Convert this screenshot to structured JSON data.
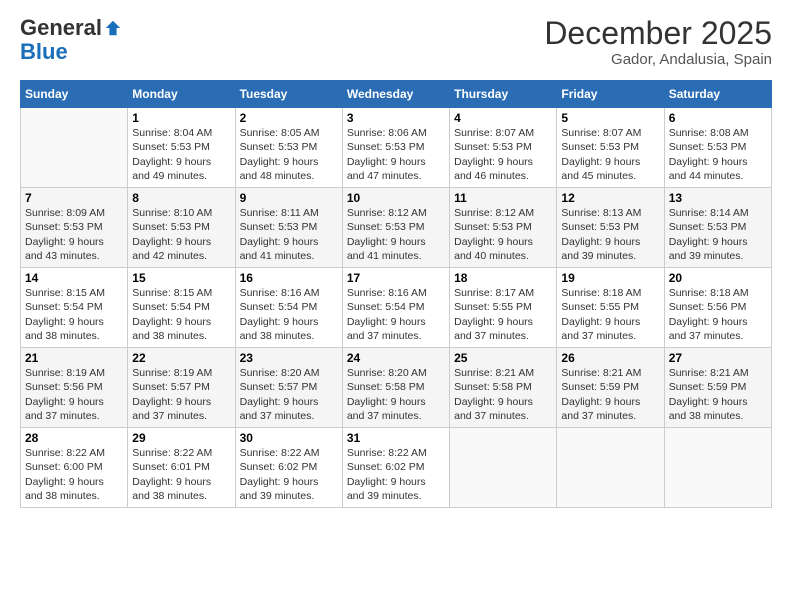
{
  "header": {
    "logo_general": "General",
    "logo_blue": "Blue",
    "month_title": "December 2025",
    "location": "Gador, Andalusia, Spain"
  },
  "calendar": {
    "days_of_week": [
      "Sunday",
      "Monday",
      "Tuesday",
      "Wednesday",
      "Thursday",
      "Friday",
      "Saturday"
    ],
    "weeks": [
      [
        {
          "day": "",
          "info": ""
        },
        {
          "day": "1",
          "info": "Sunrise: 8:04 AM\nSunset: 5:53 PM\nDaylight: 9 hours\nand 49 minutes."
        },
        {
          "day": "2",
          "info": "Sunrise: 8:05 AM\nSunset: 5:53 PM\nDaylight: 9 hours\nand 48 minutes."
        },
        {
          "day": "3",
          "info": "Sunrise: 8:06 AM\nSunset: 5:53 PM\nDaylight: 9 hours\nand 47 minutes."
        },
        {
          "day": "4",
          "info": "Sunrise: 8:07 AM\nSunset: 5:53 PM\nDaylight: 9 hours\nand 46 minutes."
        },
        {
          "day": "5",
          "info": "Sunrise: 8:07 AM\nSunset: 5:53 PM\nDaylight: 9 hours\nand 45 minutes."
        },
        {
          "day": "6",
          "info": "Sunrise: 8:08 AM\nSunset: 5:53 PM\nDaylight: 9 hours\nand 44 minutes."
        }
      ],
      [
        {
          "day": "7",
          "info": "Sunrise: 8:09 AM\nSunset: 5:53 PM\nDaylight: 9 hours\nand 43 minutes."
        },
        {
          "day": "8",
          "info": "Sunrise: 8:10 AM\nSunset: 5:53 PM\nDaylight: 9 hours\nand 42 minutes."
        },
        {
          "day": "9",
          "info": "Sunrise: 8:11 AM\nSunset: 5:53 PM\nDaylight: 9 hours\nand 41 minutes."
        },
        {
          "day": "10",
          "info": "Sunrise: 8:12 AM\nSunset: 5:53 PM\nDaylight: 9 hours\nand 41 minutes."
        },
        {
          "day": "11",
          "info": "Sunrise: 8:12 AM\nSunset: 5:53 PM\nDaylight: 9 hours\nand 40 minutes."
        },
        {
          "day": "12",
          "info": "Sunrise: 8:13 AM\nSunset: 5:53 PM\nDaylight: 9 hours\nand 39 minutes."
        },
        {
          "day": "13",
          "info": "Sunrise: 8:14 AM\nSunset: 5:53 PM\nDaylight: 9 hours\nand 39 minutes."
        }
      ],
      [
        {
          "day": "14",
          "info": "Sunrise: 8:15 AM\nSunset: 5:54 PM\nDaylight: 9 hours\nand 38 minutes."
        },
        {
          "day": "15",
          "info": "Sunrise: 8:15 AM\nSunset: 5:54 PM\nDaylight: 9 hours\nand 38 minutes."
        },
        {
          "day": "16",
          "info": "Sunrise: 8:16 AM\nSunset: 5:54 PM\nDaylight: 9 hours\nand 38 minutes."
        },
        {
          "day": "17",
          "info": "Sunrise: 8:16 AM\nSunset: 5:54 PM\nDaylight: 9 hours\nand 37 minutes."
        },
        {
          "day": "18",
          "info": "Sunrise: 8:17 AM\nSunset: 5:55 PM\nDaylight: 9 hours\nand 37 minutes."
        },
        {
          "day": "19",
          "info": "Sunrise: 8:18 AM\nSunset: 5:55 PM\nDaylight: 9 hours\nand 37 minutes."
        },
        {
          "day": "20",
          "info": "Sunrise: 8:18 AM\nSunset: 5:56 PM\nDaylight: 9 hours\nand 37 minutes."
        }
      ],
      [
        {
          "day": "21",
          "info": "Sunrise: 8:19 AM\nSunset: 5:56 PM\nDaylight: 9 hours\nand 37 minutes."
        },
        {
          "day": "22",
          "info": "Sunrise: 8:19 AM\nSunset: 5:57 PM\nDaylight: 9 hours\nand 37 minutes."
        },
        {
          "day": "23",
          "info": "Sunrise: 8:20 AM\nSunset: 5:57 PM\nDaylight: 9 hours\nand 37 minutes."
        },
        {
          "day": "24",
          "info": "Sunrise: 8:20 AM\nSunset: 5:58 PM\nDaylight: 9 hours\nand 37 minutes."
        },
        {
          "day": "25",
          "info": "Sunrise: 8:21 AM\nSunset: 5:58 PM\nDaylight: 9 hours\nand 37 minutes."
        },
        {
          "day": "26",
          "info": "Sunrise: 8:21 AM\nSunset: 5:59 PM\nDaylight: 9 hours\nand 37 minutes."
        },
        {
          "day": "27",
          "info": "Sunrise: 8:21 AM\nSunset: 5:59 PM\nDaylight: 9 hours\nand 38 minutes."
        }
      ],
      [
        {
          "day": "28",
          "info": "Sunrise: 8:22 AM\nSunset: 6:00 PM\nDaylight: 9 hours\nand 38 minutes."
        },
        {
          "day": "29",
          "info": "Sunrise: 8:22 AM\nSunset: 6:01 PM\nDaylight: 9 hours\nand 38 minutes."
        },
        {
          "day": "30",
          "info": "Sunrise: 8:22 AM\nSunset: 6:02 PM\nDaylight: 9 hours\nand 39 minutes."
        },
        {
          "day": "31",
          "info": "Sunrise: 8:22 AM\nSunset: 6:02 PM\nDaylight: 9 hours\nand 39 minutes."
        },
        {
          "day": "",
          "info": ""
        },
        {
          "day": "",
          "info": ""
        },
        {
          "day": "",
          "info": ""
        }
      ]
    ]
  }
}
